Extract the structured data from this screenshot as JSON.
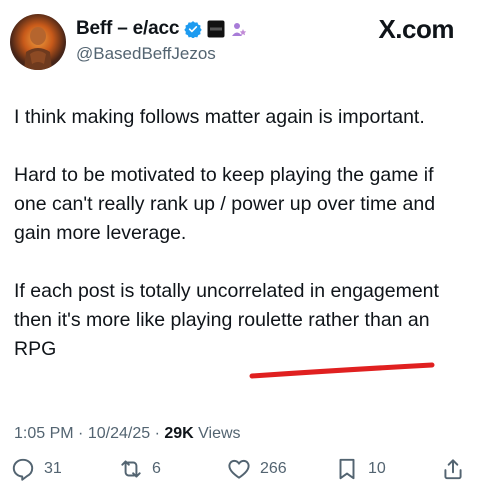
{
  "author": {
    "name": "Beff – e/acc",
    "handle": "@BasedBeffJezos",
    "avatar_icon": "profile-avatar-icon",
    "badges": [
      "verified-badge-icon",
      "affiliate-badge-icon",
      "people-badge-icon"
    ]
  },
  "brand": "X.com",
  "post": {
    "paragraphs": [
      "I think making follows matter again is important.",
      "Hard to be motivated to keep playing the game if one can't really rank up / power up over time and gain more leverage.",
      "If each post is totally uncorrelated in engagement then it's more like playing roulette rather than an RPG"
    ]
  },
  "meta": {
    "time": "1:05 PM",
    "date": "10/24/25",
    "views_count": "29K",
    "views_label": "Views"
  },
  "actions": {
    "replies": "31",
    "reposts": "6",
    "likes": "266",
    "bookmarks": "10"
  },
  "colors": {
    "accent": "#1d9bf0",
    "underline": "#e02020",
    "secondary_text": "#536471"
  }
}
